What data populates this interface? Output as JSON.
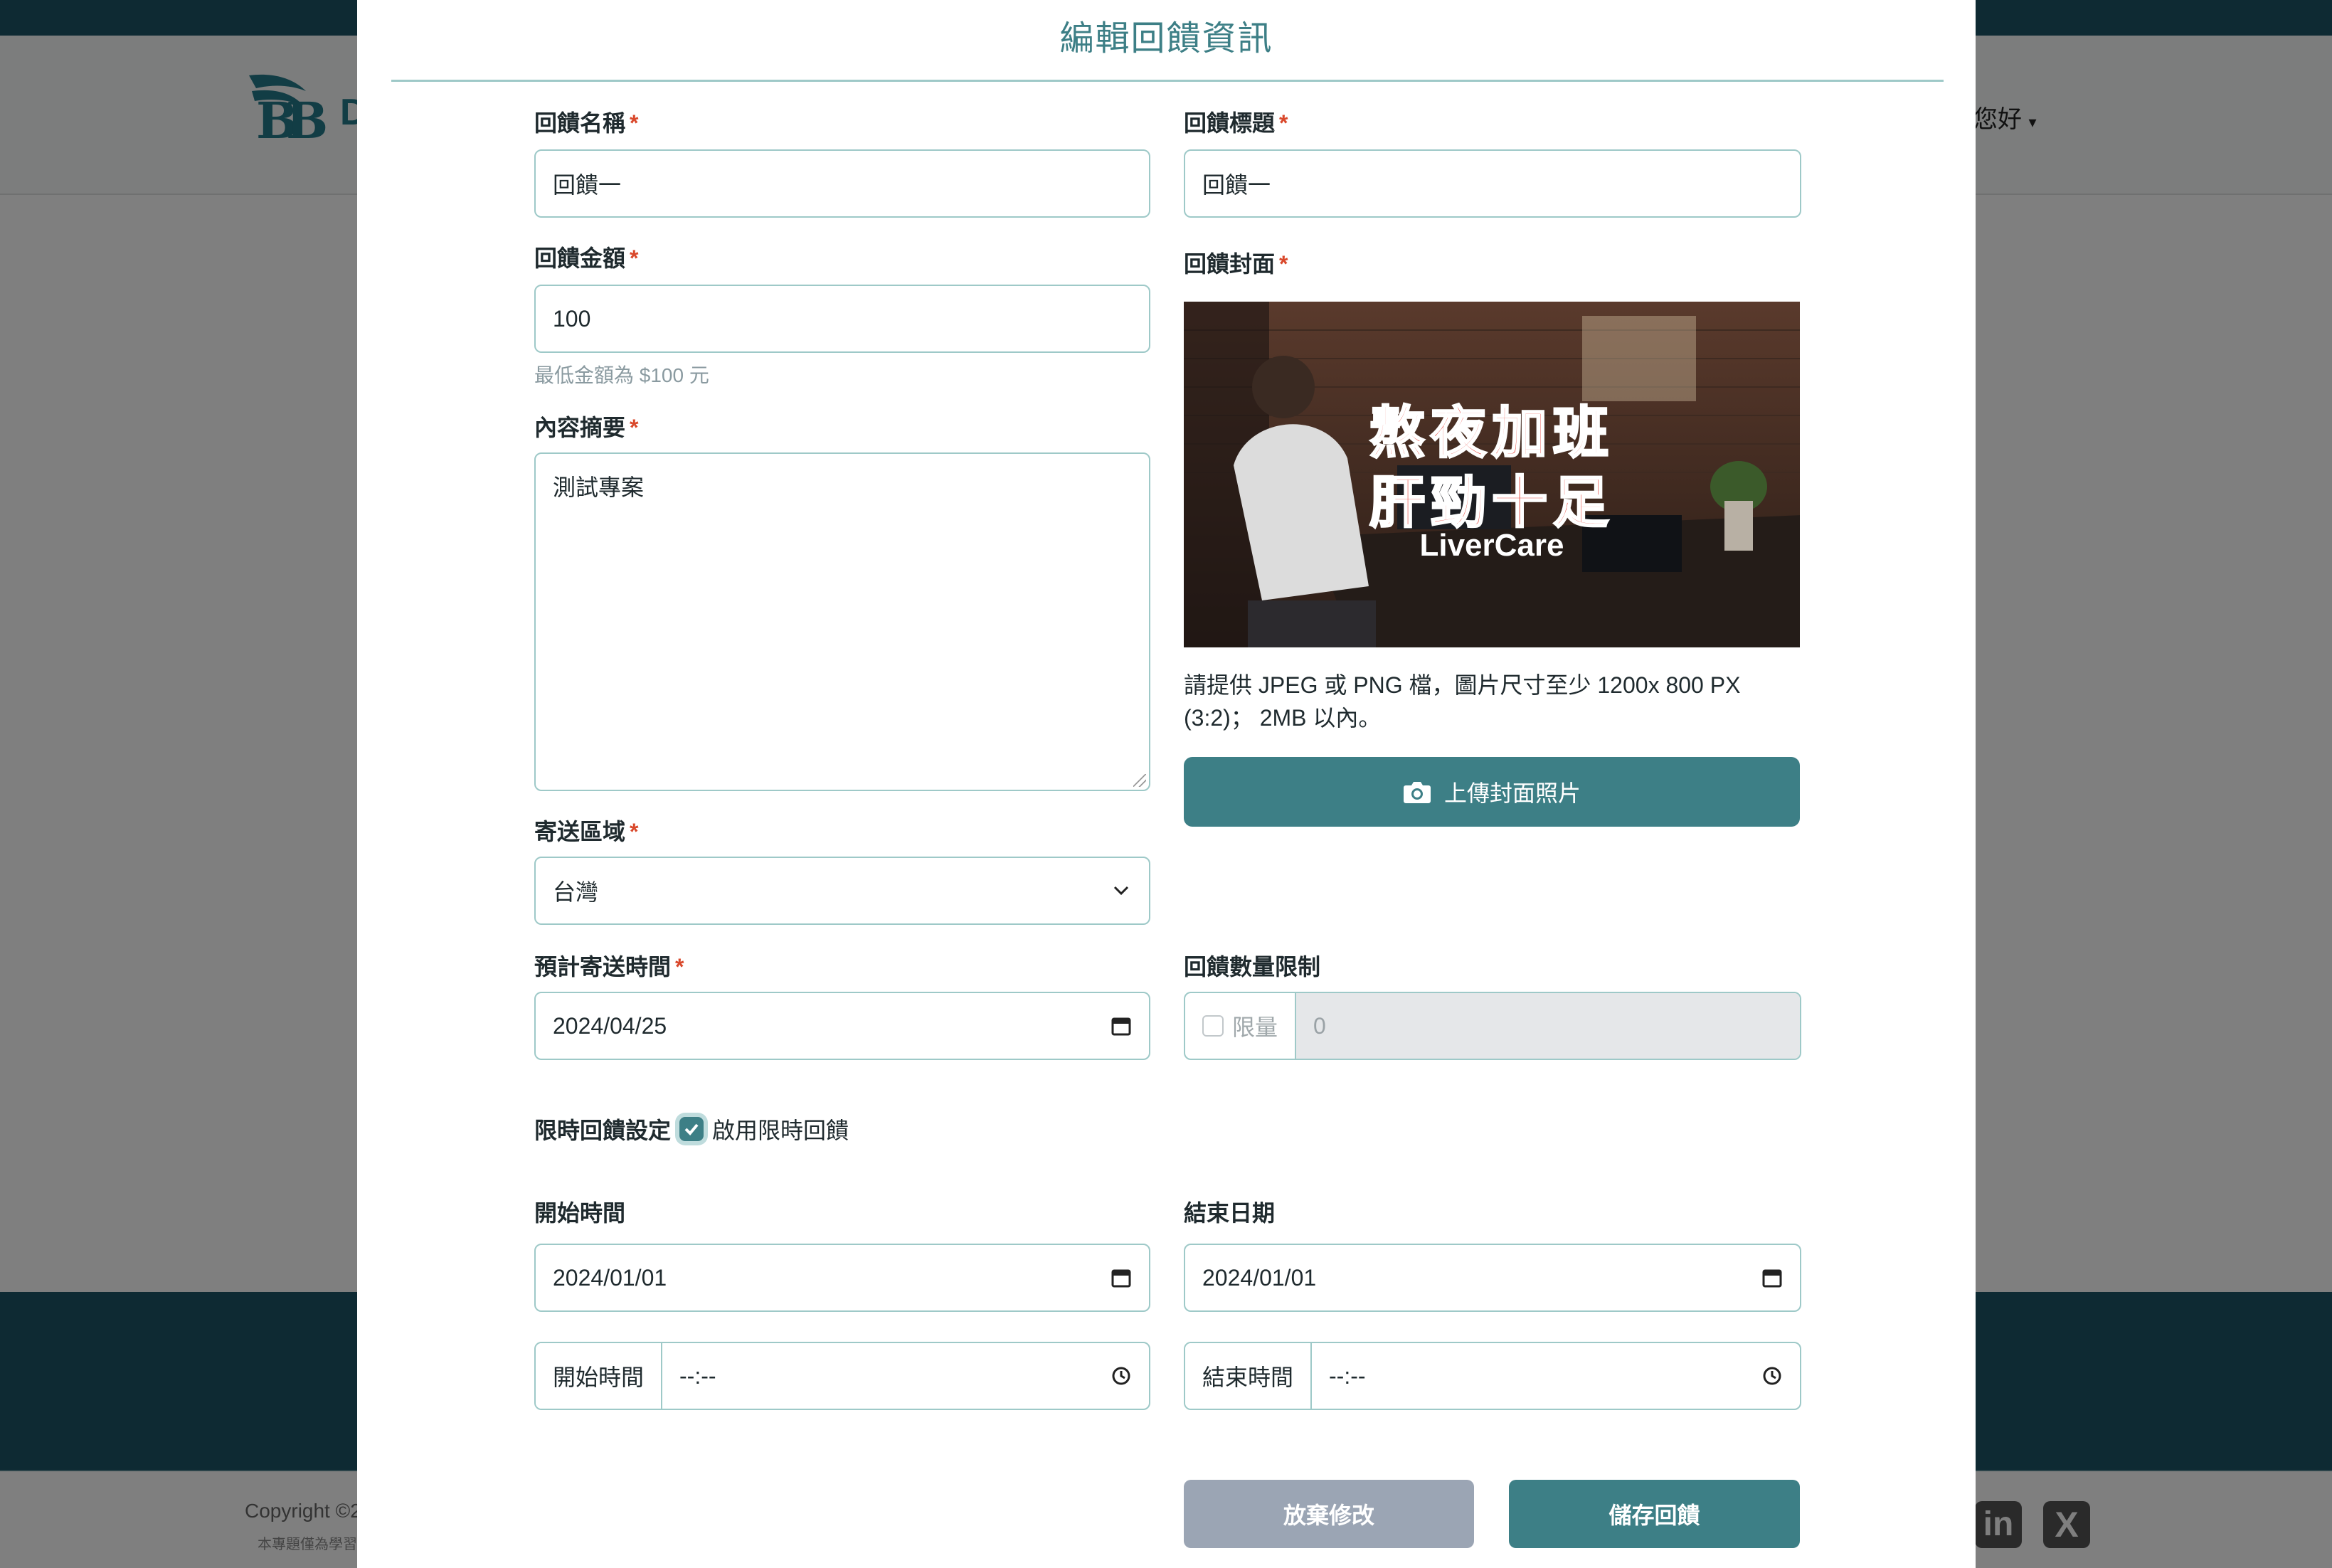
{
  "background": {
    "logo_text": "D",
    "greeting": "求您好",
    "copyright": "Copyright ©2",
    "footer_note": "本專題僅為學習",
    "social": {
      "linkedin": "in",
      "x": "X"
    }
  },
  "modal": {
    "title": "編輯回饋資訊"
  },
  "form": {
    "reward_name": {
      "label": "回饋名稱",
      "required": "*",
      "value": "回饋一"
    },
    "reward_title": {
      "label": "回饋標題",
      "required": "*",
      "value": "回饋一"
    },
    "reward_amount": {
      "label": "回饋金額",
      "required": "*",
      "value": "100",
      "hint": "最低金額為 $100 元"
    },
    "reward_cover": {
      "label": "回饋封面",
      "required": "*",
      "image_line1": "熬夜加班",
      "image_line2": "肝勁十足",
      "image_brand": "LiverCare",
      "note": "請提供 JPEG 或 PNG 檔，圖片尺寸至少 1200x 800 PX (3:2)； 2MB 以內。",
      "upload_label": "上傳封面照片"
    },
    "summary": {
      "label": "內容摘要",
      "required": "*",
      "value": "測試專案"
    },
    "shipping_region": {
      "label": "寄送區域",
      "required": "*",
      "value": "台灣"
    },
    "estimated_shipping": {
      "label": "預計寄送時間",
      "required": "*",
      "value": "2024/04/25"
    },
    "quantity_limit": {
      "label": "回饋數量限制",
      "checkbox_label": "限量",
      "value": "0",
      "checked": false
    },
    "limited_time": {
      "label": "限時回饋設定",
      "checkbox_label": "啟用限時回饋",
      "checked": true
    },
    "start_date": {
      "label": "開始時間",
      "value": "2024/01/01"
    },
    "end_date": {
      "label": "結束日期",
      "value": "2024/01/01"
    },
    "start_time": {
      "prefix": "開始時間",
      "value": "--:--"
    },
    "end_time": {
      "prefix": "結束時間",
      "value": "--:--"
    }
  },
  "buttons": {
    "cancel": "放棄修改",
    "save": "儲存回饋"
  },
  "colors": {
    "accent": "#3d7f86",
    "border": "#9ec9c8",
    "required": "#d9482b",
    "cancel_button": "#9ba5b4",
    "dark_band": "#0e2a33"
  }
}
